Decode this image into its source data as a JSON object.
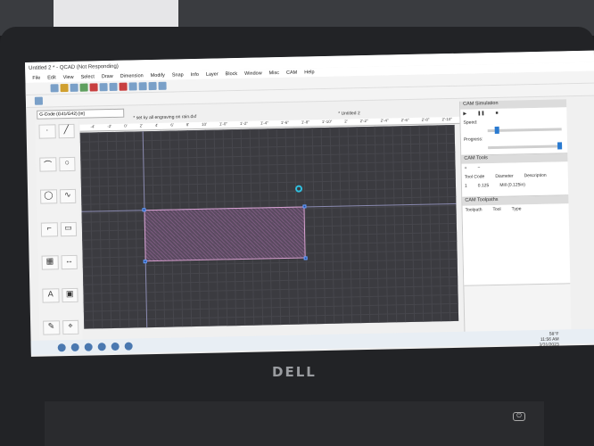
{
  "window": {
    "title": "Untitled 2 * - QCAD (Not Responding)"
  },
  "menu": [
    "File",
    "Edit",
    "View",
    "Select",
    "Draw",
    "Dimension",
    "Modify",
    "Snap",
    "Info",
    "Layer",
    "Block",
    "Window",
    "Misc",
    "CAM",
    "Help"
  ],
  "gcode_select": {
    "value": "G-Code (G41/G42) [in]"
  },
  "tabs": {
    "first": "* set ky all engraving on rain.dxf",
    "second": "* Untitled 2"
  },
  "ruler": [
    "-4'",
    "-2'",
    "0'",
    "2'",
    "4'",
    "6'",
    "8'",
    "10'",
    "1'-0\"",
    "1'-2\"",
    "1'-4\"",
    "1'-6\"",
    "1'-8\"",
    "1'-10\"",
    "2'",
    "2'-2\"",
    "2'-4\"",
    "2'-6\"",
    "2'-8\"",
    "2'-10\"",
    "3'-0\"",
    "3'"
  ],
  "cam_simulation": {
    "title": "CAM Simulation",
    "speed_label": "Speed:",
    "progress_label": "Progress:",
    "speed": 0.1,
    "progress": 1.0
  },
  "cam_tools": {
    "title": "CAM Tools",
    "headers": [
      "Tool Code",
      "Diameter",
      "Description"
    ],
    "rows": [
      [
        "1",
        "0.125",
        "Mill (0.125in)"
      ]
    ]
  },
  "cam_toolpaths": {
    "title": "CAM Toolpaths",
    "headers": [
      "Toolpath",
      "Tool",
      "Type"
    ]
  },
  "taskbar": {
    "weather": "58°F",
    "time": "11:56 AM",
    "date": "3/31/2023"
  },
  "brand": "DELL"
}
